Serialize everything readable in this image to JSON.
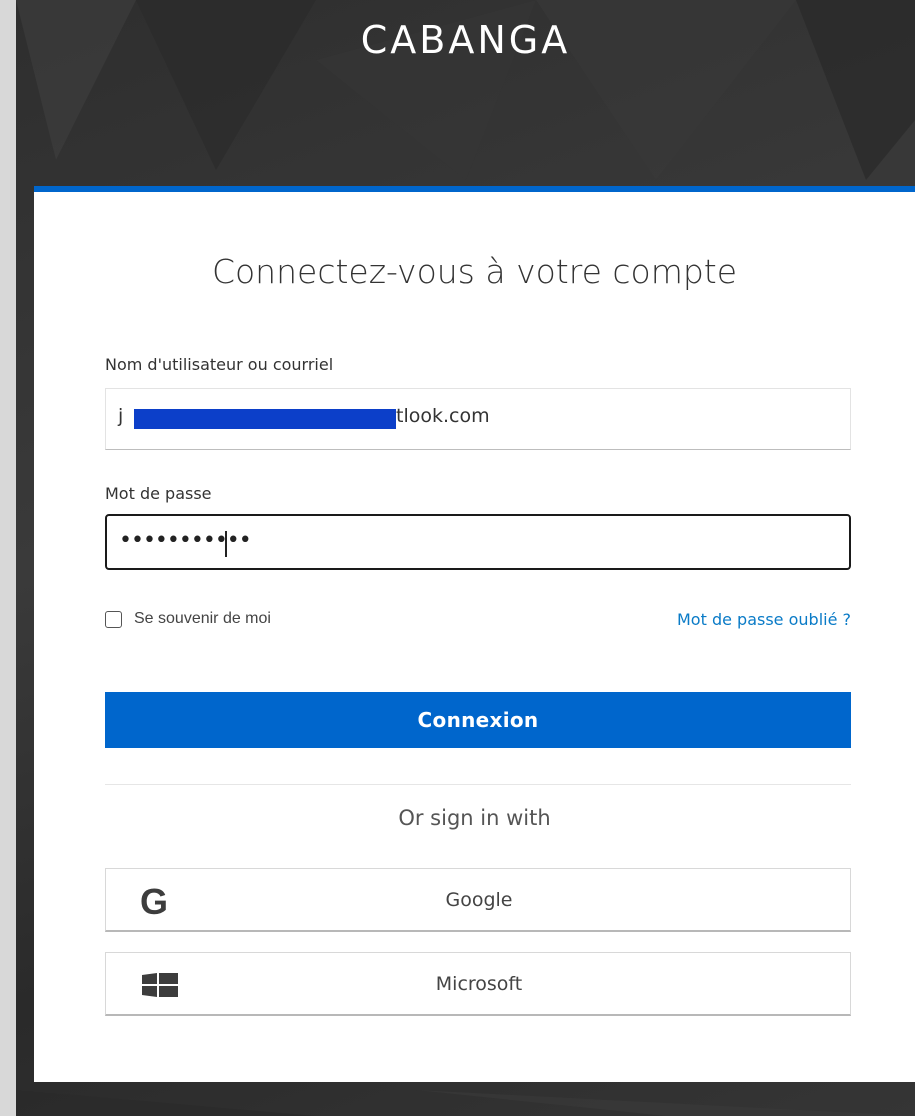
{
  "brand": {
    "name": "CABANGA"
  },
  "login": {
    "title": "Connectez-vous à votre compte",
    "username_label": "Nom d'utilisateur ou courriel",
    "username_value": "tlook.com",
    "password_label": "Mot de passe",
    "password_value": "•••••••••••",
    "remember_label": "Se souvenir de moi",
    "forgot_label": "Mot de passe oublié ?",
    "submit_label": "Connexion",
    "or_text": "Or sign in with"
  },
  "providers": [
    {
      "label": "Google",
      "icon": "google-icon"
    },
    {
      "label": "Microsoft",
      "icon": "windows-icon"
    }
  ],
  "colors": {
    "accent": "#0066cc",
    "link": "#0a7bc7",
    "background": "#333333"
  }
}
